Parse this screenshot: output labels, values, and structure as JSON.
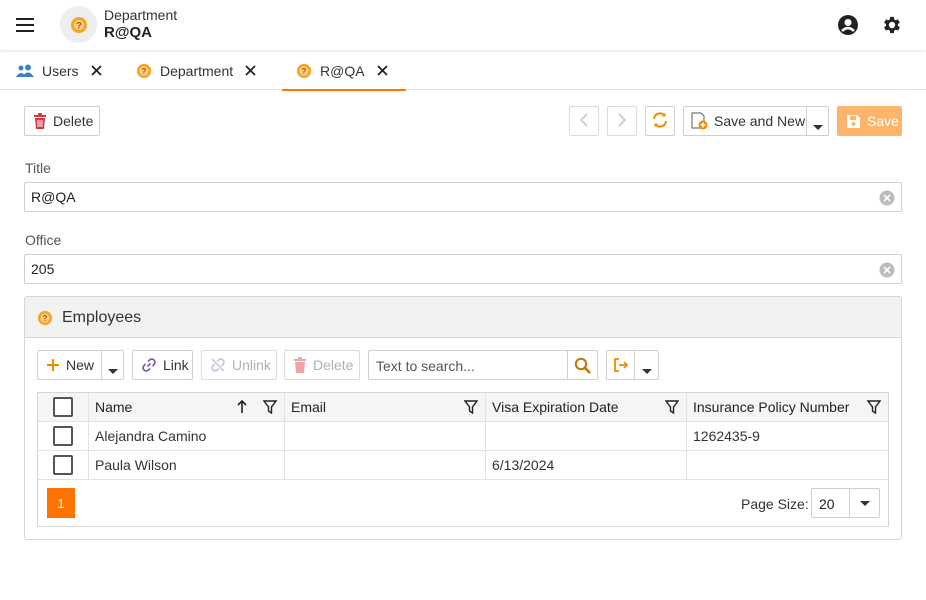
{
  "header": {
    "subtitle": "Department",
    "title": "R@QA",
    "accent": "#ff7200"
  },
  "tabs": [
    {
      "label": "Users",
      "icon": "users-icon"
    },
    {
      "label": "Department",
      "icon": "department-icon"
    },
    {
      "label": "R@QA",
      "icon": "department-icon",
      "active": true
    }
  ],
  "toolbar": {
    "delete_label": "Delete",
    "save_and_new_label": "Save and New",
    "save_label": "Save"
  },
  "form": {
    "title_label": "Title",
    "title_value": "R@QA",
    "office_label": "Office",
    "office_value": "205"
  },
  "employees": {
    "title": "Employees",
    "new_label": "New",
    "link_label": "Link",
    "unlink_label": "Unlink",
    "delete_label": "Delete",
    "search_placeholder": "Text to search...",
    "columns": [
      "Name",
      "Email",
      "Visa Expiration Date",
      "Insurance Policy Number"
    ],
    "rows": [
      {
        "name": "Alejandra Camino",
        "email": "",
        "visa": "",
        "insurance": "1262435-9"
      },
      {
        "name": "Paula Wilson",
        "email": "",
        "visa": "6/13/2024",
        "insurance": ""
      }
    ],
    "page": "1",
    "page_size_label": "Page Size:",
    "page_size": "20"
  }
}
